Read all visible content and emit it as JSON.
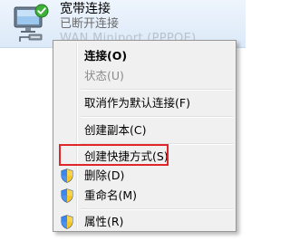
{
  "connection": {
    "name": "宽带连接",
    "status": "已断开连接",
    "device": "WAN Miniport (PPPOE)",
    "icon": "network-connection-icon",
    "status_icon": "check-badge-icon"
  },
  "context_menu": {
    "items": [
      {
        "label": "连接(O)",
        "style": "bold",
        "icon": null
      },
      {
        "label": "状态(U)",
        "style": "disabled",
        "icon": null
      },
      {
        "label": "取消作为默认连接(F)",
        "style": "normal",
        "icon": null
      },
      {
        "label": "创建副本(C)",
        "style": "normal",
        "icon": null
      },
      {
        "label": "创建快捷方式(S)",
        "style": "normal",
        "icon": null,
        "annotated": true
      },
      {
        "label": "删除(D)",
        "style": "normal",
        "icon": "uac-shield-icon"
      },
      {
        "label": "重命名(M)",
        "style": "normal",
        "icon": "uac-shield-icon"
      },
      {
        "label": "属性(R)",
        "style": "normal",
        "icon": "uac-shield-icon"
      }
    ]
  },
  "colors": {
    "annotation_border": "#e0262b",
    "menu_background": "#f0f0f0",
    "menu_border": "#979797",
    "item_selected_background": "#dce9f8"
  }
}
